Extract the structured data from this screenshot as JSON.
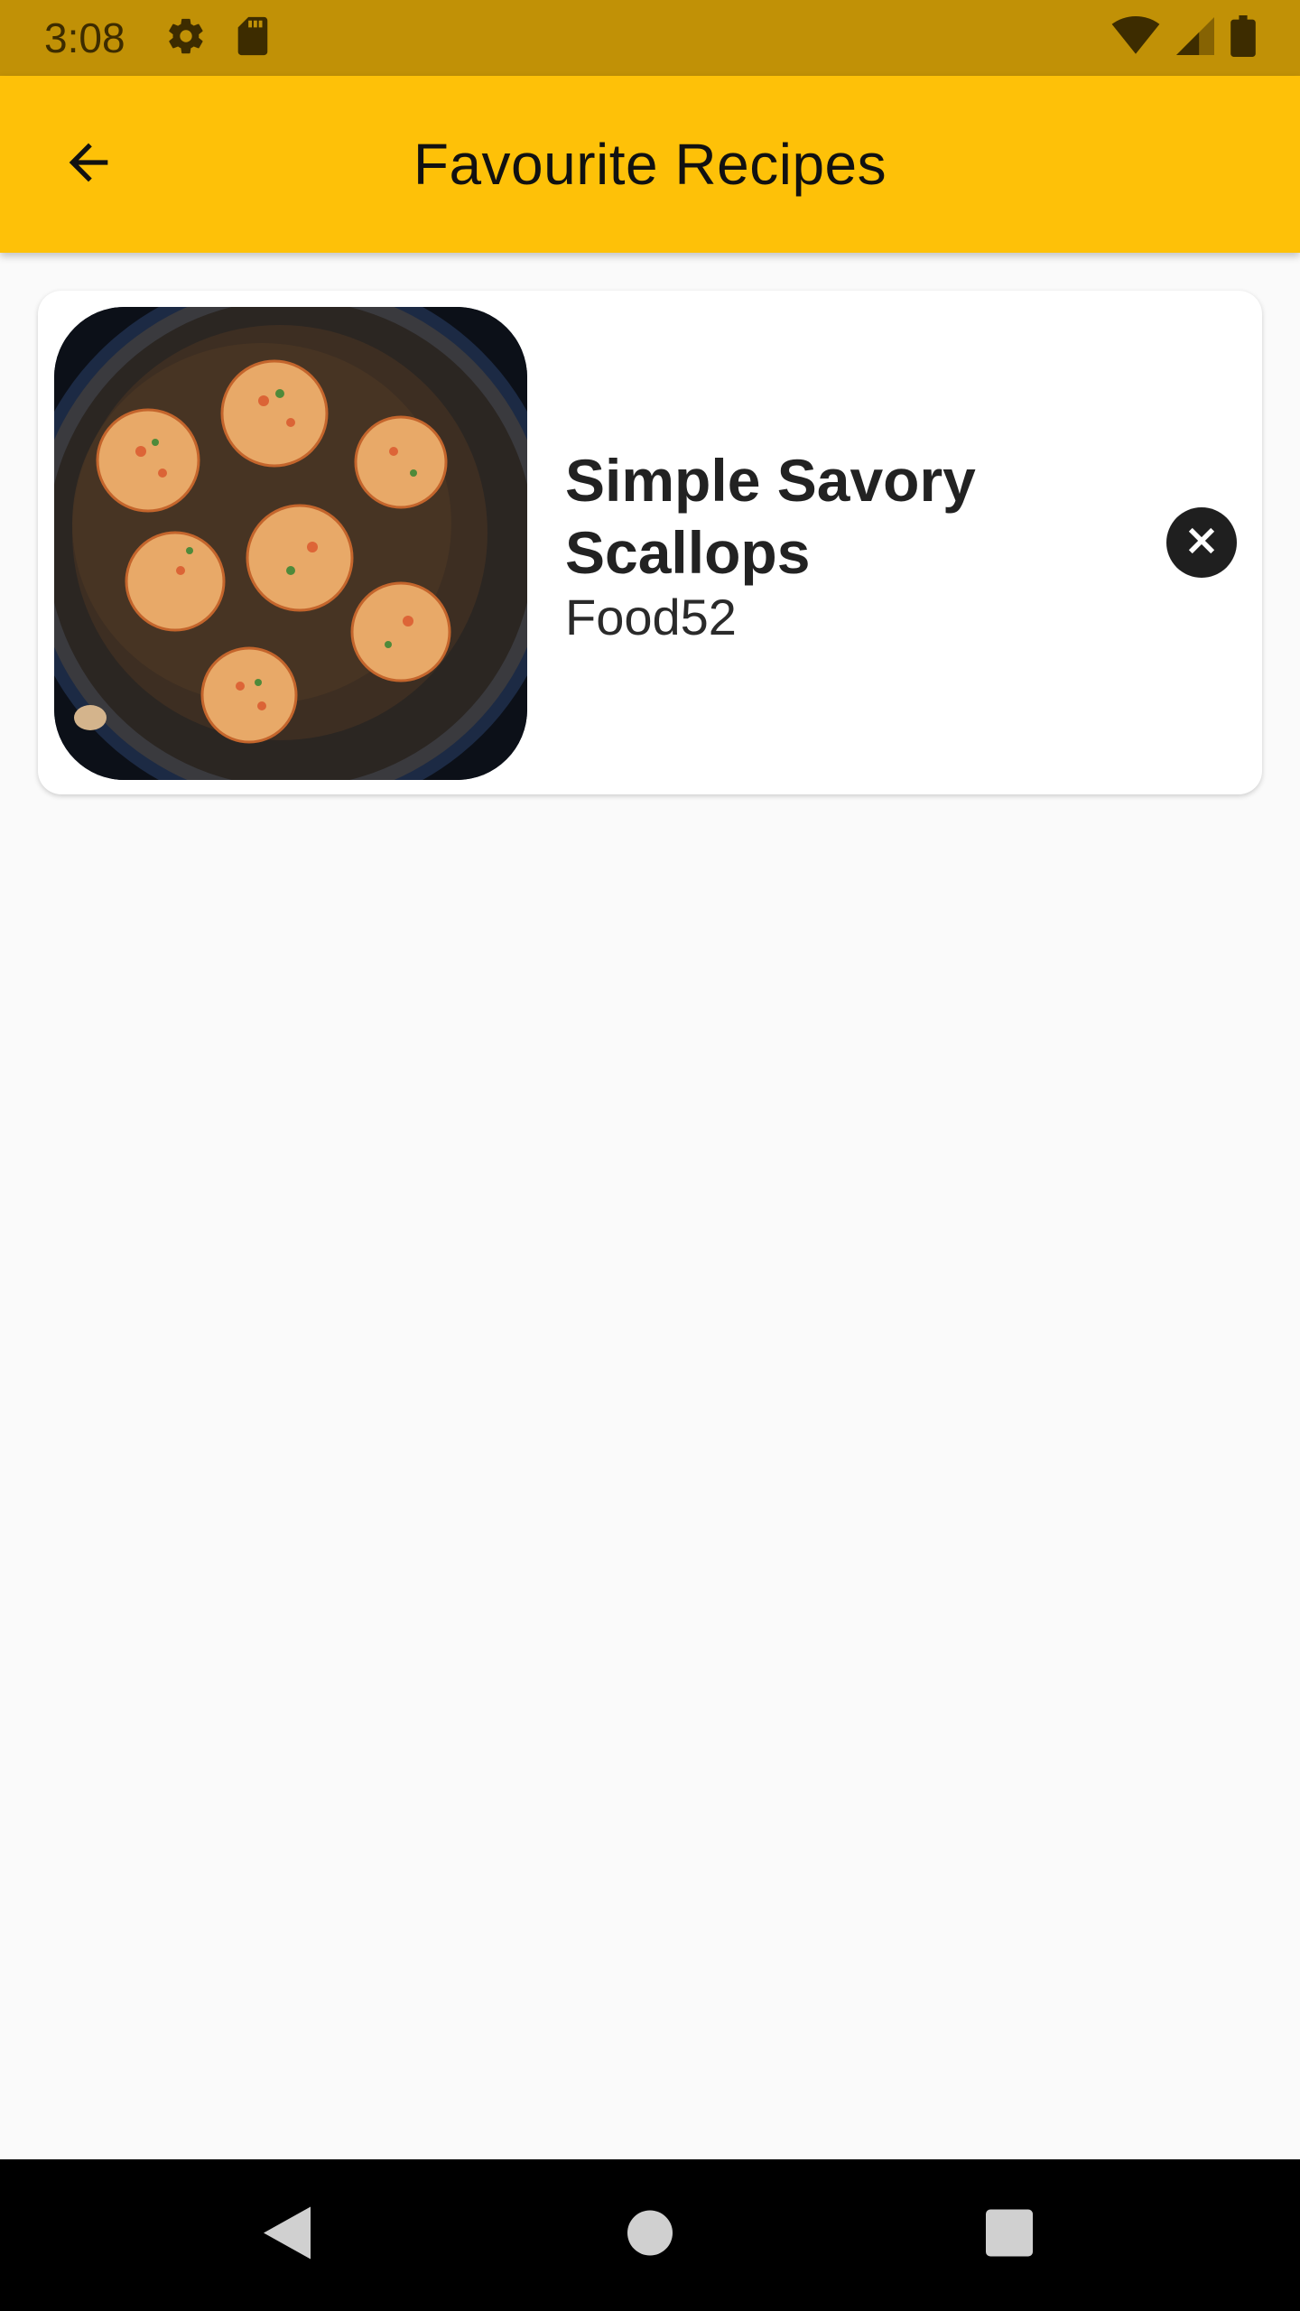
{
  "status_bar": {
    "time": "3:08",
    "icons": [
      "settings-icon",
      "sd-card-icon",
      "wifi-icon",
      "cell-signal-icon",
      "battery-icon"
    ],
    "color": "#c19106"
  },
  "app_bar": {
    "title": "Favourite Recipes",
    "back_icon": "arrow-back-icon",
    "color": "#fec108"
  },
  "favourites": [
    {
      "title": "Simple Savory Scallops",
      "source": "Food52",
      "image_desc": "seared scallops in a dark pan",
      "remove_icon": "close-circle-icon"
    }
  ],
  "nav_bar": {
    "buttons": [
      "back-triangle-icon",
      "home-circle-icon",
      "recents-square-icon"
    ]
  }
}
